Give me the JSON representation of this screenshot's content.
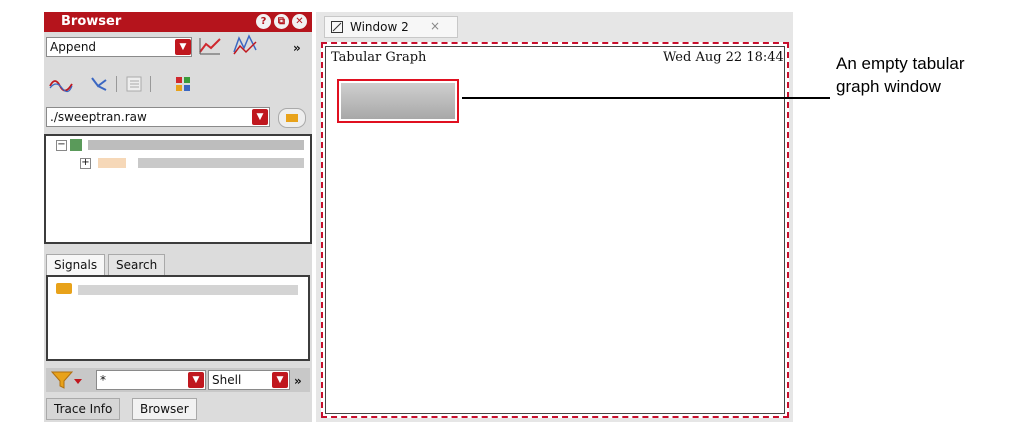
{
  "browser": {
    "title": "Browser",
    "title_buttons": [
      "?",
      "⧉",
      "✕"
    ],
    "mode_select": "Append",
    "overflow": "»",
    "file_select": "./sweeptran.raw",
    "tabs": [
      "Signals",
      "Search"
    ],
    "filter_value": "*",
    "shell_select": "Shell",
    "bottom_tabs": [
      "Trace Info",
      "Browser"
    ]
  },
  "window": {
    "tab_label": "Window 2",
    "tab_close": "×",
    "graph_title": "Tabular Graph",
    "timestamp": "Wed Aug 22 18:44"
  },
  "annotation": {
    "line1": "An empty tabular",
    "line2": "graph window"
  },
  "colors": {
    "accent": "#b5141c",
    "highlight": "#e01020"
  }
}
